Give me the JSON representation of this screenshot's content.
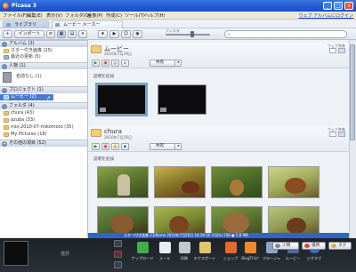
{
  "window": {
    "title": "Picasa 3",
    "controls": [
      "_",
      "□",
      "×"
    ]
  },
  "menu": {
    "items": [
      "ファイル(F)",
      "編集(E)",
      "表示(V)",
      "フォルダ(O)",
      "画像(P)",
      "作成(C)",
      "ツール(T)",
      "ヘルプ(H)"
    ],
    "signin": "ウェブ アルバムにログイン"
  },
  "tabs": [
    "ライブラリ",
    "ムービー メーカー"
  ],
  "toolbar": {
    "import": "インポート",
    "filter_label": "フィルタ",
    "search_placeholder": ""
  },
  "sidebar": {
    "sections": [
      {
        "label": "アルバム (2)",
        "items": [
          "スター付き画像 (25)",
          "最近の更新 (5)"
        ]
      },
      {
        "label": "人物 (1)",
        "items": [
          "名前なし (1)"
        ]
      },
      {
        "label": "プロジェクト (1)",
        "items": [
          "ムービー (2)"
        ]
      },
      {
        "label": "フォルダ (4)",
        "items": [
          "chura (43)",
          "azuba (33)",
          "mix-2010-07-mikomoto (35)",
          "My Pictures (18)"
        ]
      },
      {
        "label": "その他の項目 (52)",
        "items": []
      }
    ]
  },
  "main": {
    "sections": [
      {
        "title": "ムービー",
        "date": "2010年7月29日",
        "share": "共有",
        "caption": "説明を追加",
        "web_label": "ウェブ共有"
      },
      {
        "title": "chura",
        "date": "2010年7月26日",
        "share": "共有",
        "caption": "説明を追加",
        "web_label": "ウェブ共有"
      }
    ]
  },
  "statusbar": {
    "text": "スター付き画像 21/Kame     2010年7月26日 18:28:30     1024×768  ●  5.8 MB"
  },
  "tray": {
    "selection_label": "選択",
    "actions": [
      "アップロード",
      "メール",
      "印刷",
      "エクスポート",
      "ショップ",
      "BlogThis!",
      "コラージュ",
      "ムービー",
      "ジオタグ"
    ],
    "people_button": "人物",
    "places_button": "場所",
    "tags_button": "タグ"
  },
  "colors": {
    "titlebar": "#1f5ad0",
    "selection": "#4a7cc9",
    "status": "#2f66c6",
    "tray": "#23272e"
  }
}
